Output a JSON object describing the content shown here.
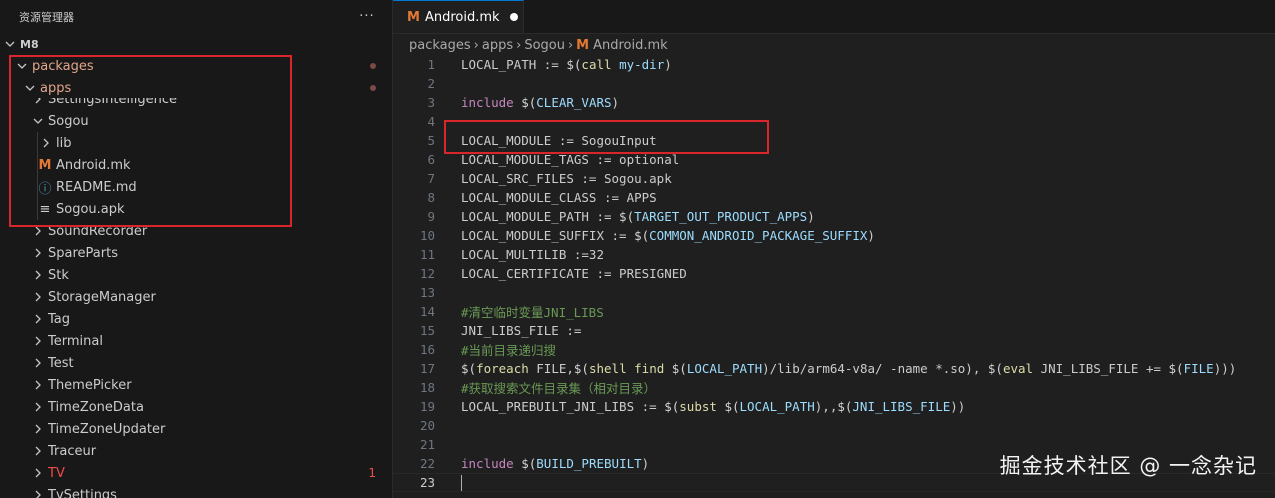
{
  "sidebar": {
    "title": "资源管理器",
    "more": "···",
    "root": "M8",
    "rows": [
      {
        "label": "packages",
        "modified": true
      },
      {
        "label": "apps",
        "modified": true
      },
      {
        "label": "SettingsIntelligence"
      },
      {
        "label": "Sogou"
      },
      {
        "label": "lib"
      },
      {
        "label": "Android.mk",
        "icon": "M"
      },
      {
        "label": "README.md",
        "icon": "ⓘ"
      },
      {
        "label": "Sogou.apk",
        "icon": "≡"
      },
      {
        "label": "SoundRecorder"
      },
      {
        "label": "SpareParts"
      },
      {
        "label": "Stk"
      },
      {
        "label": "StorageManager"
      },
      {
        "label": "Tag"
      },
      {
        "label": "Terminal"
      },
      {
        "label": "Test"
      },
      {
        "label": "ThemePicker"
      },
      {
        "label": "TimeZoneData"
      },
      {
        "label": "TimeZoneUpdater"
      },
      {
        "label": "Traceur"
      },
      {
        "label": "TV",
        "badge": "1"
      },
      {
        "label": "TvSettings"
      }
    ]
  },
  "tab": {
    "icon": "M",
    "label": "Android.mk"
  },
  "breadcrumb": [
    "packages",
    "apps",
    "Sogou",
    "Android.mk"
  ],
  "breadcrumb_icon": "M",
  "code_lines": [
    "LOCAL_PATH := $(call my-dir)",
    "",
    "include $(CLEAR_VARS)",
    "",
    "LOCAL_MODULE := SogouInput",
    "LOCAL_MODULE_TAGS := optional",
    "LOCAL_SRC_FILES := Sogou.apk",
    "LOCAL_MODULE_CLASS := APPS",
    "LOCAL_MODULE_PATH := $(TARGET_OUT_PRODUCT_APPS)",
    "LOCAL_MODULE_SUFFIX := $(COMMON_ANDROID_PACKAGE_SUFFIX)",
    "LOCAL_MULTILIB :=32",
    "LOCAL_CERTIFICATE := PRESIGNED",
    "",
    "#清空临时变量JNI_LIBS",
    "JNI_LIBS_FILE :=",
    "#当前目录递归搜",
    "$(foreach FILE,$(shell find $(LOCAL_PATH)/lib/arm64-v8a/ -name *.so), $(eval JNI_LIBS_FILE += $(FILE)))",
    "#获取搜索文件目录集（相对目录）",
    "LOCAL_PREBUILT_JNI_LIBS := $(subst $(LOCAL_PATH),,$(JNI_LIBS_FILE))",
    "",
    "",
    "include $(BUILD_PREBUILT)",
    ""
  ],
  "watermark": "掘金技术社区 @ 一念杂记",
  "colors": {
    "accent": "#0078d4",
    "annotation_box": "#d9262c",
    "modified": "#e2a58b",
    "error": "#f14c4c"
  }
}
